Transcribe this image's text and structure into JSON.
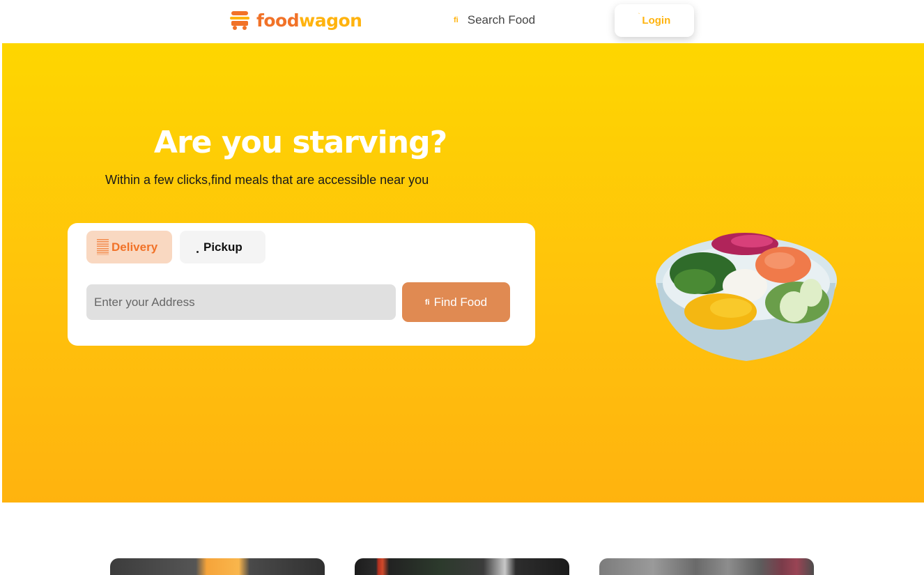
{
  "navbar": {
    "brand": {
      "food": "food",
      "wagon": "wagon"
    },
    "search_icon": "fi",
    "search_label": "Search Food",
    "login_icon": "`",
    "login_label": "Login"
  },
  "hero": {
    "title": "Are you starving?",
    "subtitle": "Within a few clicks,find meals that are accessible near you",
    "tabs": [
      {
        "label": "Delivery",
        "icon": "lines-icon",
        "active": true
      },
      {
        "label": "Pickup",
        "icon": "dot-icon",
        "active": false
      }
    ],
    "address_placeholder": "Enter your Address",
    "find_icon": "fi",
    "find_label": "Find Food"
  },
  "colors": {
    "primary_orange": "#f17228",
    "brand_yellow": "#ffb30e",
    "hero_top": "#fed600",
    "hero_bottom": "#ffb30e",
    "find_button": "#e08a52",
    "delivery_tab_bg": "#f9d8c1"
  }
}
